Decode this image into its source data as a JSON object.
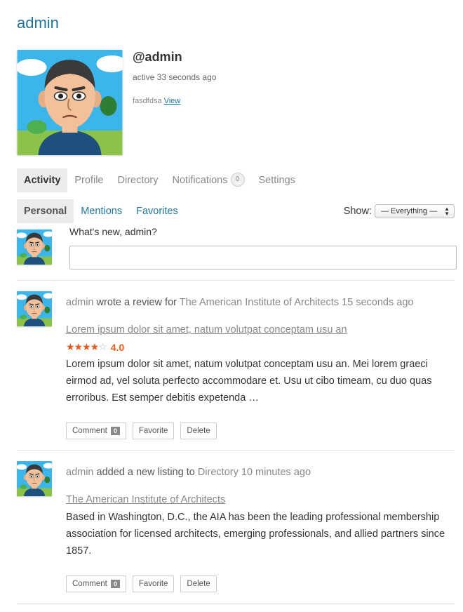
{
  "page": {
    "title": "admin"
  },
  "profile": {
    "handle": "@admin",
    "last_active": "active 33 seconds ago",
    "latest_update": "fasdfdsa",
    "view_link": "View"
  },
  "main_nav": [
    {
      "label": "Activity"
    },
    {
      "label": "Profile"
    },
    {
      "label": "Directory"
    },
    {
      "label": "Notifications",
      "count": "0"
    },
    {
      "label": "Settings"
    }
  ],
  "sub_nav": [
    {
      "label": "Personal"
    },
    {
      "label": "Mentions"
    },
    {
      "label": "Favorites"
    }
  ],
  "filter": {
    "label": "Show:",
    "selected": "— Everything —"
  },
  "post_form": {
    "prompt": "What's new, admin?",
    "placeholder": ""
  },
  "activities": [
    {
      "user": "admin",
      "action": "wrote a review for",
      "target": "The American Institute of Architects",
      "time": "15 seconds ago",
      "title": "Lorem ipsum dolor sit amet, natum volutpat conceptam usu an",
      "rating_value": "4.0",
      "rating_stars": 4,
      "body": "Lorem ipsum dolor sit amet, natum volutpat conceptam usu an. Mei lorem graeci eirmod ad, vel soluta perfecto accommodare et. Usu ut cibo timeam, cu duo quas erroribus. Est semper debitis expetenda …",
      "buttons": {
        "comment": "Comment",
        "comment_count": "0",
        "favorite": "Favorite",
        "delete": "Delete"
      }
    },
    {
      "user": "admin",
      "action": "added a new listing to",
      "target": "Directory",
      "time": "10 minutes ago",
      "title": "The American Institute of Architects",
      "body": "Based in Washington, D.C., the AIA has been the leading professional membership association for licensed architects, emerging professionals, and allied partners since 1857.",
      "buttons": {
        "comment": "Comment",
        "comment_count": "0",
        "favorite": "Favorite",
        "delete": "Delete"
      }
    }
  ],
  "colors": {
    "link": "#21759b",
    "rating": "#e45d1c",
    "tab_active_bg": "#ececec"
  }
}
